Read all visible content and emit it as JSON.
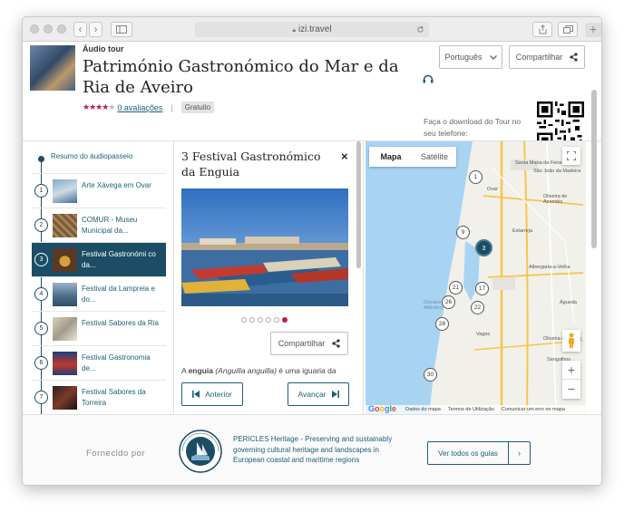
{
  "browser": {
    "address": "izi.travel"
  },
  "header": {
    "type_label": "Áudio tour",
    "title": "Património Gastronómico do Mar e da Ria de Aveiro",
    "stars": 4,
    "ratings_link": "0 avaliações",
    "separator": "|",
    "badge": "Gratuito",
    "language_label": "Português",
    "share_label": "Compartilhar",
    "download_text": "Faça o download do Tour no seu telefone:"
  },
  "sidebar": {
    "summary_label": "Resumo do áudiopasseio",
    "items": [
      {
        "num": "1",
        "label": "Arte Xávega em Ovar"
      },
      {
        "num": "2",
        "label": "COMUR - Museu Municipal da..."
      },
      {
        "num": "3",
        "label": "Festival Gastronómi co da..."
      },
      {
        "num": "4",
        "label": "Festival da Lampreia e do..."
      },
      {
        "num": "5",
        "label": "Festival Sabores da Ria"
      },
      {
        "num": "6",
        "label": "Festival Gastronomia de..."
      },
      {
        "num": "7",
        "label": "Festival Sabores da Torreira"
      }
    ]
  },
  "detail": {
    "title": "3 Festival Gastronómico da Enguia",
    "close_label": "×",
    "share_label": "Compartilhar",
    "desc_prefix": "A ",
    "desc_bold": "enguia",
    "desc_italic": "(Anguilla anguilla)",
    "desc_rest": " é uma iguaria da",
    "prev_label": "Anterior",
    "next_label": "Avançar"
  },
  "map": {
    "tab_map": "Mapa",
    "tab_satellite": "Satélite",
    "zoom_in": "+",
    "zoom_out": "−",
    "places": [
      "Santa Maria da Feira",
      "São João da Madeira",
      "Ovar",
      "Oliveira de Azeméis",
      "Estarreja",
      "Albergaria-a-Velha",
      "Vagos",
      "Águeda",
      "Oliveira do Bairro",
      "Sangalhos",
      "Oceano Atlântico"
    ],
    "pins": [
      "1",
      "9",
      "3",
      "21",
      "17",
      "26",
      "22",
      "28",
      "30"
    ],
    "google_label": "Google",
    "footer_links": [
      "Dados do mapa",
      "Termos de Utilização",
      "Comunicar um erro no mapa"
    ]
  },
  "footer": {
    "provided_by": "Fornecido por",
    "org_text": "PERICLES Heritage - Preserving and sustainably governing cultural heritage and landscapes in European coastal and maritime regions",
    "all_guides_label": "Ver todos os guias",
    "arrow": "›"
  },
  "colors": {
    "accent": "#1b4d66",
    "link": "#1d5f7a",
    "star": "#c2185b"
  }
}
